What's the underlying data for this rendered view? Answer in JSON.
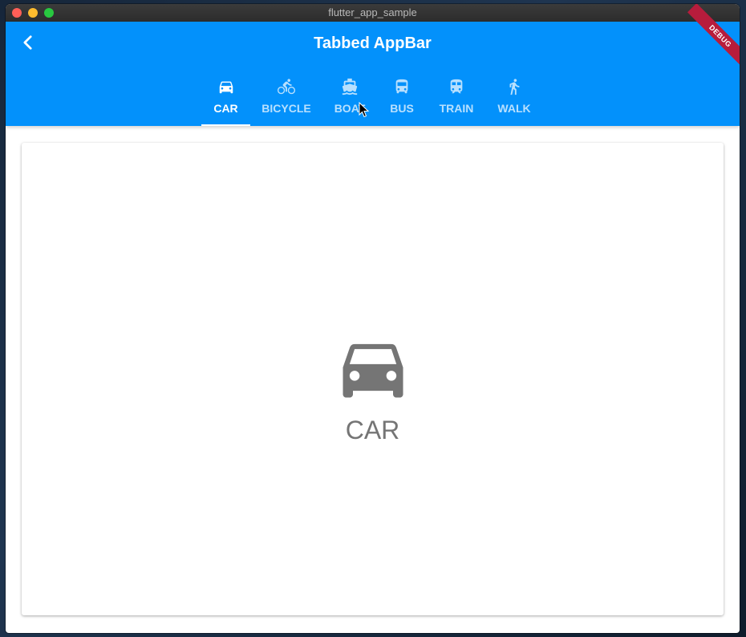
{
  "window": {
    "title": "flutter_app_sample"
  },
  "appbar": {
    "title": "Tabbed AppBar",
    "debug_label": "DEBUG",
    "color": "#0391fb"
  },
  "tabs": [
    {
      "label": "CAR",
      "icon": "car-icon",
      "active": true
    },
    {
      "label": "BICYCLE",
      "icon": "bicycle-icon",
      "active": false
    },
    {
      "label": "BOAT",
      "icon": "boat-icon",
      "active": false
    },
    {
      "label": "BUS",
      "icon": "bus-icon",
      "active": false
    },
    {
      "label": "TRAIN",
      "icon": "train-icon",
      "active": false
    },
    {
      "label": "WALK",
      "icon": "walk-icon",
      "active": false
    }
  ],
  "content": {
    "icon": "car-icon",
    "label": "CAR",
    "icon_color": "#757575"
  }
}
